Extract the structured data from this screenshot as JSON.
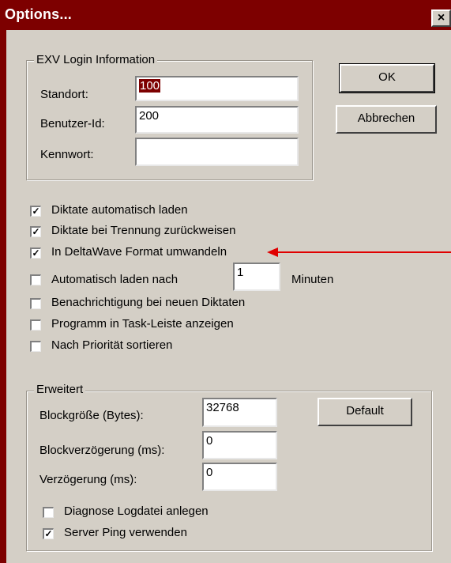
{
  "window": {
    "title": "Options...",
    "close_glyph": "×"
  },
  "login": {
    "group_title": "EXV Login Information",
    "standort_label": "Standort:",
    "standort_value": "100",
    "benutzer_label": "Benutzer-Id:",
    "benutzer_value": "200",
    "kennwort_label": "Kennwort:",
    "kennwort_value": ""
  },
  "buttons": {
    "ok": "OK",
    "cancel": "Abbrechen",
    "default": "Default"
  },
  "options": [
    {
      "label": "Diktate automatisch laden",
      "checked": true
    },
    {
      "label": "Diktate bei Trennung zurückweisen",
      "checked": true
    },
    {
      "label": "In DeltaWave Format umwandeln",
      "checked": true
    },
    {
      "label": "Automatisch laden nach",
      "checked": false
    },
    {
      "label": "Benachrichtigung bei neuen Diktaten",
      "checked": false
    },
    {
      "label": "Programm in Task-Leiste anzeigen",
      "checked": false
    },
    {
      "label": "Nach Priorität sortieren",
      "checked": false
    }
  ],
  "auto_load": {
    "minutes_value": "1",
    "minutes_unit": "Minuten"
  },
  "advanced": {
    "group_title": "Erweitert",
    "block_size_label": "Blockgröße (Bytes):",
    "block_size_value": "32768",
    "block_delay_label": "Blockverzögerung (ms):",
    "block_delay_value": "0",
    "delay_label": "Verzögerung (ms):",
    "delay_value": "0",
    "diag_label": "Diagnose Logdatei anlegen",
    "diag_checked": false,
    "ping_label": "Server Ping verwenden",
    "ping_checked": true
  },
  "colors": {
    "title_bar": "#7d0000",
    "dialog_bg": "#d4cfc6",
    "annotation_arrow": "#e00000"
  },
  "check_glyph": "✓"
}
